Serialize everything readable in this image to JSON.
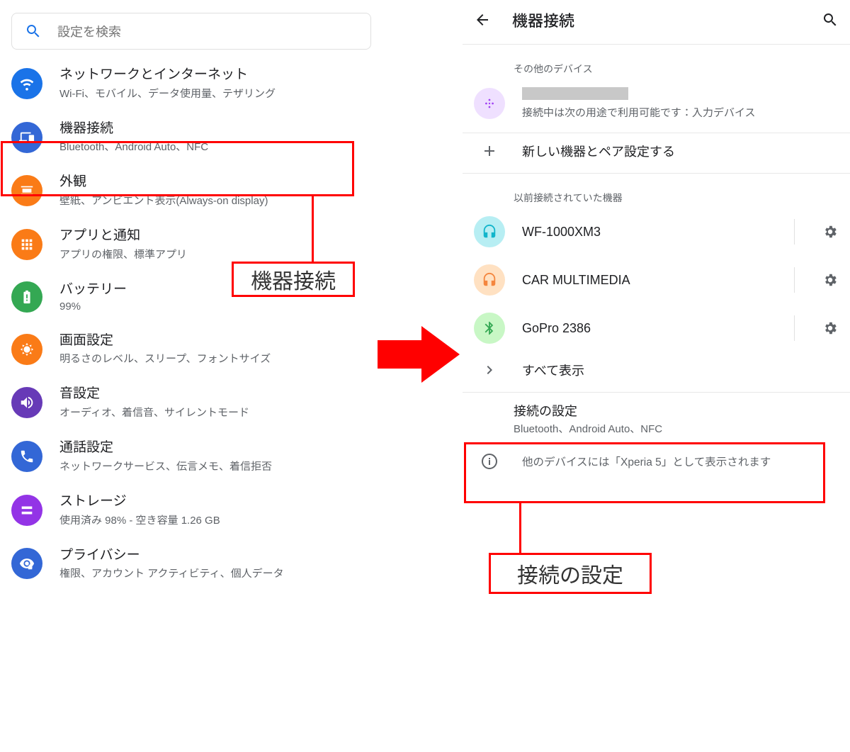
{
  "left": {
    "search_placeholder": "設定を検索",
    "items": [
      {
        "title": "ネットワークとインターネット",
        "subtitle": "Wi-Fi、モバイル、データ使用量、テザリング",
        "icon": "wifi",
        "color": "#1a73e8"
      },
      {
        "title": "機器接続",
        "subtitle": "Bluetooth、Android Auto、NFC",
        "icon": "devices",
        "color": "#3367d6"
      },
      {
        "title": "外観",
        "subtitle": "壁紙、アンビエント表示(Always-on display)",
        "icon": "wallpaper",
        "color": "#fa7b17"
      },
      {
        "title": "アプリと通知",
        "subtitle": "アプリの権限、標準アプリ",
        "icon": "apps",
        "color": "#fa7b17"
      },
      {
        "title": "バッテリー",
        "subtitle": "99%",
        "icon": "battery",
        "color": "#34a853"
      },
      {
        "title": "画面設定",
        "subtitle": "明るさのレベル、スリープ、フォントサイズ",
        "icon": "brightness",
        "color": "#fa7b17"
      },
      {
        "title": "音設定",
        "subtitle": "オーディオ、着信音、サイレントモード",
        "icon": "volume",
        "color": "#673ab7"
      },
      {
        "title": "通話設定",
        "subtitle": "ネットワークサービス、伝言メモ、着信拒否",
        "icon": "phone",
        "color": "#3367d6"
      },
      {
        "title": "ストレージ",
        "subtitle": "使用済み 98% - 空き容量 1.26 GB",
        "icon": "storage",
        "color": "#9334e6"
      },
      {
        "title": "プライバシー",
        "subtitle": "権限、アカウント アクティビティ、個人データ",
        "icon": "privacy",
        "color": "#3367d6"
      }
    ]
  },
  "right": {
    "title": "機器接続",
    "section_other": "その他のデバイス",
    "controller_sub": "接続中は次の用途で利用可能です：入力デバイス",
    "pair_new": "新しい機器とペア設定する",
    "section_prev": "以前接続されていた機器",
    "devices": [
      {
        "name": "WF-1000XM3",
        "icon": "headset",
        "color": "#b7eef3"
      },
      {
        "name": "CAR MULTIMEDIA",
        "icon": "headset",
        "color": "#ffe1c2"
      },
      {
        "name": "GoPro 2386",
        "icon": "bluetooth",
        "color": "#c8f7c5"
      }
    ],
    "show_all": "すべて表示",
    "conn_pref_title": "接続の設定",
    "conn_pref_sub": "Bluetooth、Android Auto、NFC",
    "visible_as": "他のデバイスには「Xperia 5」として表示されます"
  },
  "callouts": {
    "label1": "機器接続",
    "label2": "接続の設定"
  }
}
